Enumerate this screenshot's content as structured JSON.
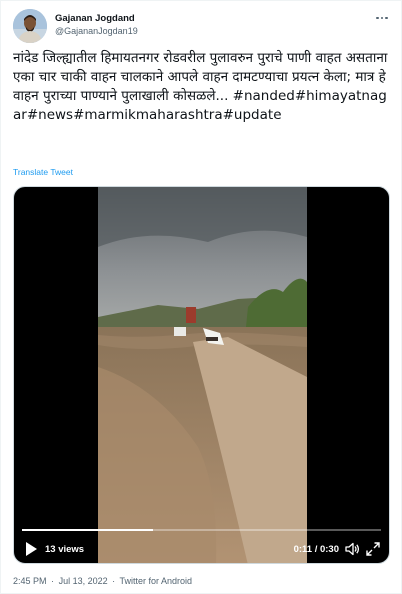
{
  "author": {
    "display_name": "Gajanan Jogdand",
    "handle": "@GajananJogdan19"
  },
  "tweet": {
    "text": "नांदेड जिल्ह्यातील हिमायतनगर रोडवरील पुलावरुन पुराचे पाणी वाहत असताना एका चार चाकी वाहन चालकाने आपले वाहन दामटण्याचा प्रयत्न केला; मात्र हे वाहन पुराच्या पाण्याने पुलाखाली कोसळले...",
    "hashtags": "#nanded#himayatnagar#news#marmikmaharashtra#update",
    "translate_label": "Translate Tweet"
  },
  "video": {
    "views_label": "13 views",
    "timecode": "0:11 / 0:30",
    "progress": 0.366
  },
  "meta": {
    "time": "2:45 PM",
    "separator": "·",
    "date": "Jul 13, 2022",
    "separator2": "·",
    "source": "Twitter for Android"
  }
}
